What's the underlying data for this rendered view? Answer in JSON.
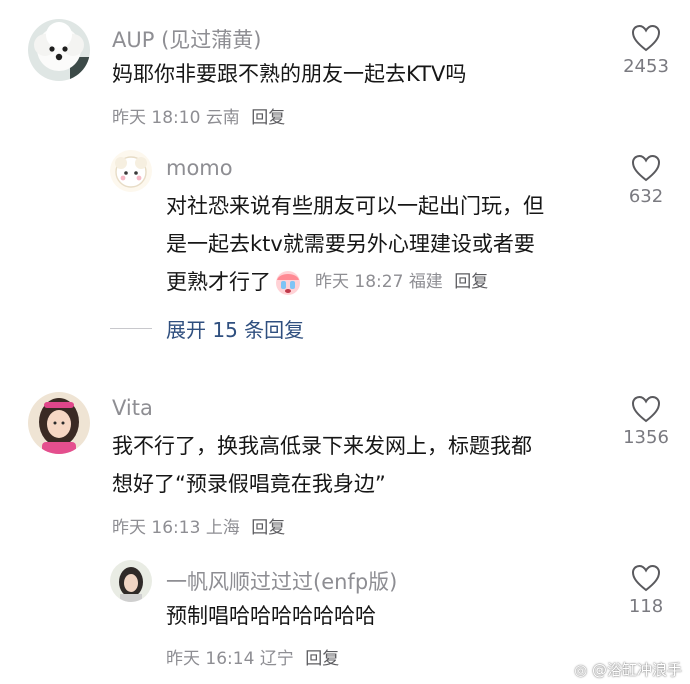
{
  "comments": [
    {
      "author": "AUP (见过蒲黄)",
      "text": "妈耶你非要跟不熟的朋友一起去KTV吗",
      "time": "昨天 18:10",
      "location": "云南",
      "reply_label": "回复",
      "likes": "2453"
    },
    {
      "author": "momo",
      "text_line1": "对社恐来说有些朋友可以一起出门玩，但",
      "text_line2": "是一起去ktv就需要另外心理建设或者要",
      "text_line3": "更熟才行了",
      "emoji": "crying-face",
      "time": "昨天 18:27",
      "location": "福建",
      "reply_label": "回复",
      "likes": "632"
    },
    {
      "author": "Vita",
      "text_line1": "我不行了，换我高低录下来发网上，标题我都",
      "text_line2": "想好了“预录假唱竟在我身边”",
      "time": "昨天 16:13",
      "location": "上海",
      "reply_label": "回复",
      "likes": "1356"
    },
    {
      "author": "一帆风顺过过过(enfp版)",
      "text": "预制唱哈哈哈哈哈哈哈",
      "time": "昨天 16:14",
      "location": "辽宁",
      "reply_label": "回复",
      "likes": "118"
    }
  ],
  "expand_replies": "展开 15 条回复",
  "watermark": "@浴缸冲浪手",
  "icons": [
    "heart-outline-icon",
    "weibo-logo-icon"
  ],
  "colors": {
    "link": "#2f4f7f",
    "meta": "#8e8e93",
    "text": "#161616"
  }
}
